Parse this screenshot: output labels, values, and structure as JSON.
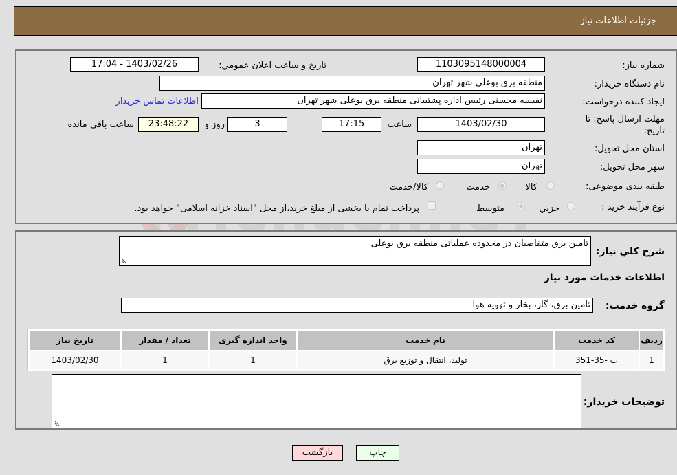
{
  "header": {
    "title": "جزئیات اطلاعات نیاز"
  },
  "form": {
    "need_number_label": "شماره نیاز:",
    "need_number": "1103095148000004",
    "announce_label": "تاریخ و ساعت اعلان عمومي:",
    "announce_value": "1403/02/26 - 17:04",
    "buyer_org_label": "نام دستگاه خریدار:",
    "buyer_org": "منطقه برق بوعلی شهر تهران",
    "requester_label": "ایجاد کننده درخواست:",
    "requester": "نفیسه محسنی رئیس اداره پشتیبانی منطقه برق بوعلی شهر تهران",
    "contact_link": "اطلاعات تماس خریدار",
    "deadline_label_1": "مهلت ارسال پاسخ: تا",
    "deadline_label_2": "تاریخ:",
    "deadline_date": "1403/02/30",
    "time_label": "ساعت",
    "deadline_time": "17:15",
    "days_value": "3",
    "days_label": "روز و",
    "remaining_time": "23:48:22",
    "remaining_label": "ساعت باقي مانده",
    "province_label": "استان محل تحویل:",
    "province": "تهران",
    "city_label": "شهر محل تحویل:",
    "city": "تهران",
    "category_label": "طبقه بندی موضوعی:",
    "category_options": [
      {
        "label": "کالا",
        "selected": false
      },
      {
        "label": "خدمت",
        "selected": true
      },
      {
        "label": "کالا/خدمت",
        "selected": false
      }
    ],
    "process_label": "نوع فرآیند خرید :",
    "process_options": [
      {
        "label": "جزيي",
        "selected": false
      },
      {
        "label": "متوسط",
        "selected": true
      }
    ],
    "treasury_note": "پرداخت تمام یا بخشی از مبلغ خرید،از محل \"اسناد خزانه اسلامی\" خواهد بود."
  },
  "details": {
    "description_label": "شرح کلي نیاز:",
    "description": "تامین برق متقاضیان در محدوده عملیاتی منطقه برق بوعلی",
    "services_title": "اطلاعات خدمات مورد نیاز",
    "service_group_label": "گروه خدمت:",
    "service_group": "تامین برق، گاز، بخار و تهویه هوا",
    "table": {
      "headers": [
        "ردیف",
        "کد خدمت",
        "نام خدمت",
        "واحد اندازه گیری",
        "تعداد / مقدار",
        "تاریخ نیاز"
      ],
      "rows": [
        [
          "1",
          "ت -35-351",
          "تولید، انتقال و توزیع برق",
          "1",
          "1",
          "1403/02/30"
        ]
      ]
    },
    "buyer_notes_label": "توضیحات خریدار:",
    "buyer_notes": ""
  },
  "buttons": {
    "print": "چاپ",
    "back": "بازگشت"
  },
  "watermark": {
    "text": "AriaTender.neT"
  }
}
